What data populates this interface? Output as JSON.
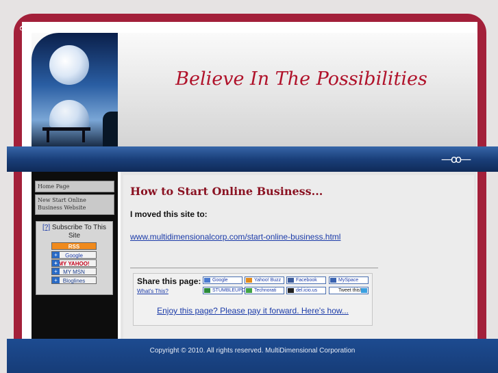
{
  "header": {
    "site_title": "Believe In The Possibilities",
    "ornament": "ಌ",
    "band_ornament": "—ꝏ—"
  },
  "sidebar": {
    "nav": [
      {
        "label": "Home Page"
      },
      {
        "label": "New Start Online Business Website"
      }
    ],
    "subscribe": {
      "help": "[?]",
      "title": "Subscribe To This Site",
      "feeds": [
        {
          "label": "RSS"
        },
        {
          "label": "Google"
        },
        {
          "label": "MY YAHOO!"
        },
        {
          "label": "MY MSN"
        },
        {
          "label": "Bloglines"
        }
      ]
    }
  },
  "main": {
    "heading": "How to Start Online Business...",
    "moved_text": "I moved this site to:",
    "moved_link": "www.multidimensionalcorp.com/start-online-business.html",
    "share": {
      "label": "Share this page:",
      "whats_this": "What's This?",
      "buttons": [
        {
          "label": "Google"
        },
        {
          "label": "Yahoo! Buzz"
        },
        {
          "label": "Facebook"
        },
        {
          "label": "MySpace"
        },
        {
          "label": "STUMBLEUPON"
        },
        {
          "label": "Technorati"
        },
        {
          "label": "del.icio.us"
        },
        {
          "label": "Tweet this!"
        }
      ]
    },
    "pay_forward": "Enjoy this page? Please pay it forward. Here's how..."
  },
  "footer": {
    "copyright": "Copyright © 2010. All rights reserved. MultiDimensional Corporation"
  },
  "colors": {
    "frame": "#a3203a",
    "band": "#1a3f7a",
    "title": "#b0122a",
    "link": "#1a3aa8"
  }
}
